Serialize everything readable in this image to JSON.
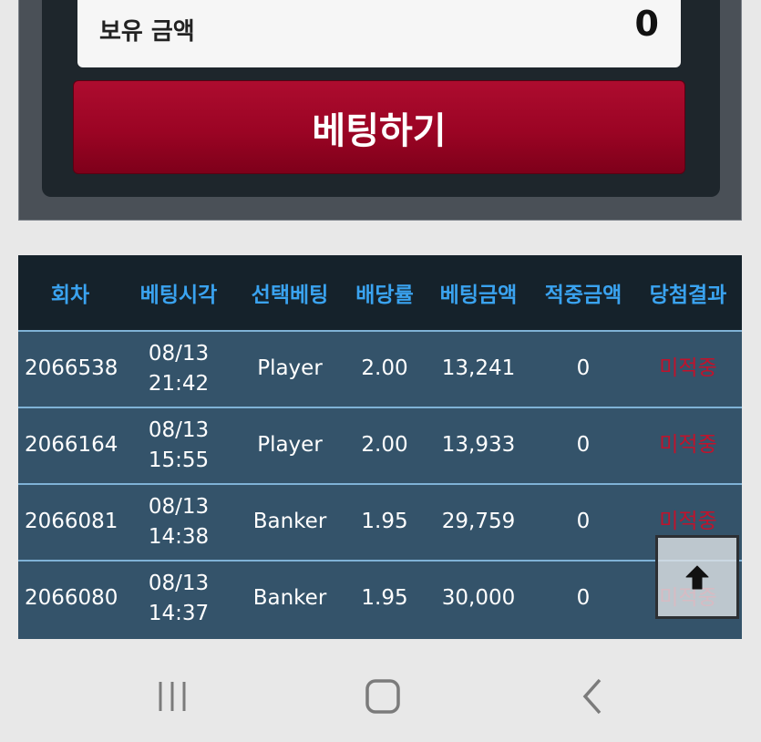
{
  "balance": {
    "label": "보유 금액",
    "value": "0"
  },
  "bet_button": {
    "label": "베팅하기"
  },
  "history": {
    "headers": [
      "회차",
      "베팅시각",
      "선택베팅",
      "배당률",
      "베팅금액",
      "적중금액",
      "당첨결과"
    ],
    "rows": [
      {
        "round": "2066538",
        "date": "08/13",
        "time": "21:42",
        "selection": "Player",
        "odds": "2.00",
        "amount": "13,241",
        "win_amount": "0",
        "result": "미적중"
      },
      {
        "round": "2066164",
        "date": "08/13",
        "time": "15:55",
        "selection": "Player",
        "odds": "2.00",
        "amount": "13,933",
        "win_amount": "0",
        "result": "미적중"
      },
      {
        "round": "2066081",
        "date": "08/13",
        "time": "14:38",
        "selection": "Banker",
        "odds": "1.95",
        "amount": "29,759",
        "win_amount": "0",
        "result": "미적중"
      },
      {
        "round": "2066080",
        "date": "08/13",
        "time": "14:37",
        "selection": "Banker",
        "odds": "1.95",
        "amount": "30,000",
        "win_amount": "0",
        "result": "미적중"
      }
    ]
  },
  "icons": {
    "scroll_top": "arrow-up-icon",
    "recent_apps": "recent-apps-icon",
    "home": "home-icon",
    "back": "back-icon"
  },
  "colors": {
    "header_text": "#3aa3f0",
    "result_text": "#c0132c",
    "bet_button": "#9b0424",
    "row_background": "#34536a"
  }
}
